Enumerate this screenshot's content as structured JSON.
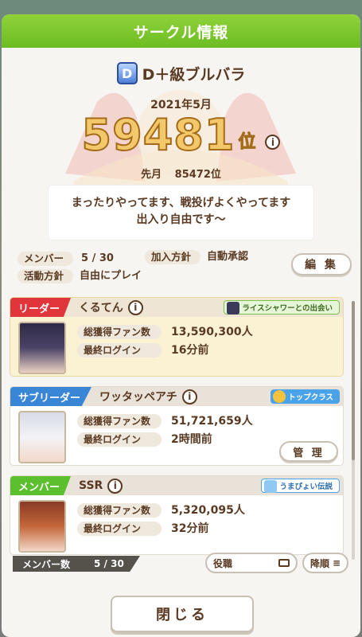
{
  "header": {
    "title": "サークル情報"
  },
  "circle": {
    "badge": "D",
    "name": "D＋級ブルバラ",
    "month": "2021年5月",
    "rank": "59481",
    "rank_unit": "位",
    "prev_label": "先月",
    "prev_rank": "85472位",
    "description_line1": "まったりやってます、戦投げよくやってます",
    "description_line2": "出入り自由です～"
  },
  "info": {
    "members_label": "メンバー",
    "members_value": "5 / 30",
    "join_label": "加入方針",
    "join_value": "自動承認",
    "activity_label": "活動方針",
    "activity_value": "自由にプレイ",
    "edit_button": "編 集"
  },
  "members": [
    {
      "role": "リーダー",
      "name": "くるてん",
      "title": "ライスシャワーとの出会い",
      "fans_label": "総獲得ファン数",
      "fans": "13,590,300人",
      "login_label": "最終ログイン",
      "login": "16分前"
    },
    {
      "role": "サブリーダー",
      "name": "ワッタッペアチ",
      "title": "トップクラス",
      "fans_label": "総獲得ファン数",
      "fans": "51,721,659人",
      "login_label": "最終ログイン",
      "login": "2時間前",
      "manage_button": "管 理"
    },
    {
      "role": "メンバー",
      "name": "SSR",
      "title": "うまぴょい伝説",
      "fans_label": "総獲得ファン数",
      "fans": "5,320,095人",
      "login_label": "最終ログイン",
      "login": "32分前"
    }
  ],
  "footer": {
    "member_count_label": "メンバー数",
    "member_count_value": "5 / 30",
    "sort_key": "役職",
    "sort_order": "降順",
    "close_button": "閉じる"
  },
  "colors": {
    "header_green": "#7cc82e",
    "leader_red": "#e0353b",
    "subleader_blue": "#3a86d6",
    "member_green": "#5bbf2e",
    "text_brown": "#5a3a22"
  }
}
